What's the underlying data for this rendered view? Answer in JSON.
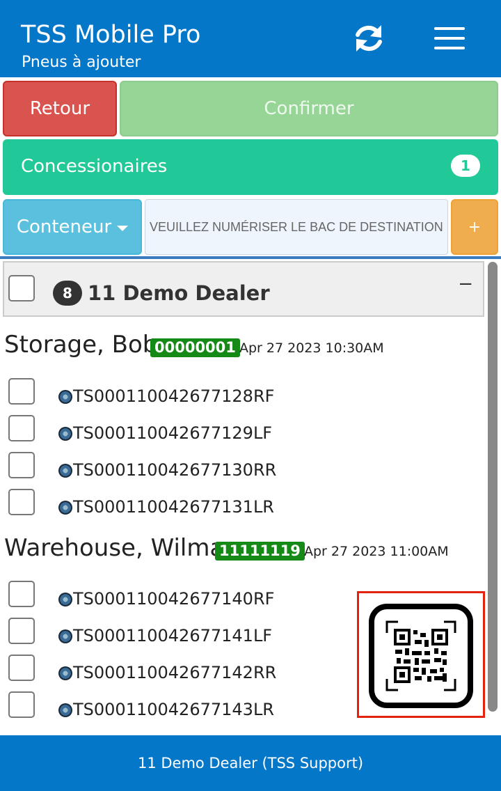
{
  "header": {
    "title": "TSS Mobile Pro",
    "subtitle": "Pneus à ajouter",
    "refresh_icon": "refresh-icon",
    "menu_icon": "hamburger-menu-icon"
  },
  "actions": {
    "back_label": "Retour",
    "confirm_label": "Confirmer"
  },
  "dealers_bar": {
    "label": "Concessionaires",
    "count": "1"
  },
  "container": {
    "button_label": "Conteneur",
    "input_placeholder": "VEUILLEZ NUMÉRISER LE BAC DE DESTINATION",
    "add_label": "+"
  },
  "dealer": {
    "count": "8",
    "name": "11 Demo Dealer",
    "collapse_label": "−"
  },
  "customers": [
    {
      "name": "Storage, Bob",
      "badge": "00000001",
      "date": "Apr 27 2023 10:30AM",
      "tires": [
        "TS000110042677128RF",
        "TS000110042677129LF",
        "TS000110042677130RR",
        "TS000110042677131LR"
      ]
    },
    {
      "name": "Warehouse, Wilma",
      "badge": "11111119",
      "date": "Apr 27 2023 11:00AM",
      "tires": [
        "TS000110042677140RF",
        "TS000110042677141LF",
        "TS000110042677142RR",
        "TS000110042677143LR"
      ]
    }
  ],
  "footer": {
    "text": "11 Demo Dealer (TSS Support)"
  },
  "colors": {
    "header_blue": "#0577c9",
    "danger": "#d9534f",
    "success_light": "#97d597",
    "teal": "#20c997",
    "info": "#5bc0de",
    "warning": "#f0ad4e",
    "badge_green": "#168a16",
    "qr_highlight": "#e2240f"
  }
}
